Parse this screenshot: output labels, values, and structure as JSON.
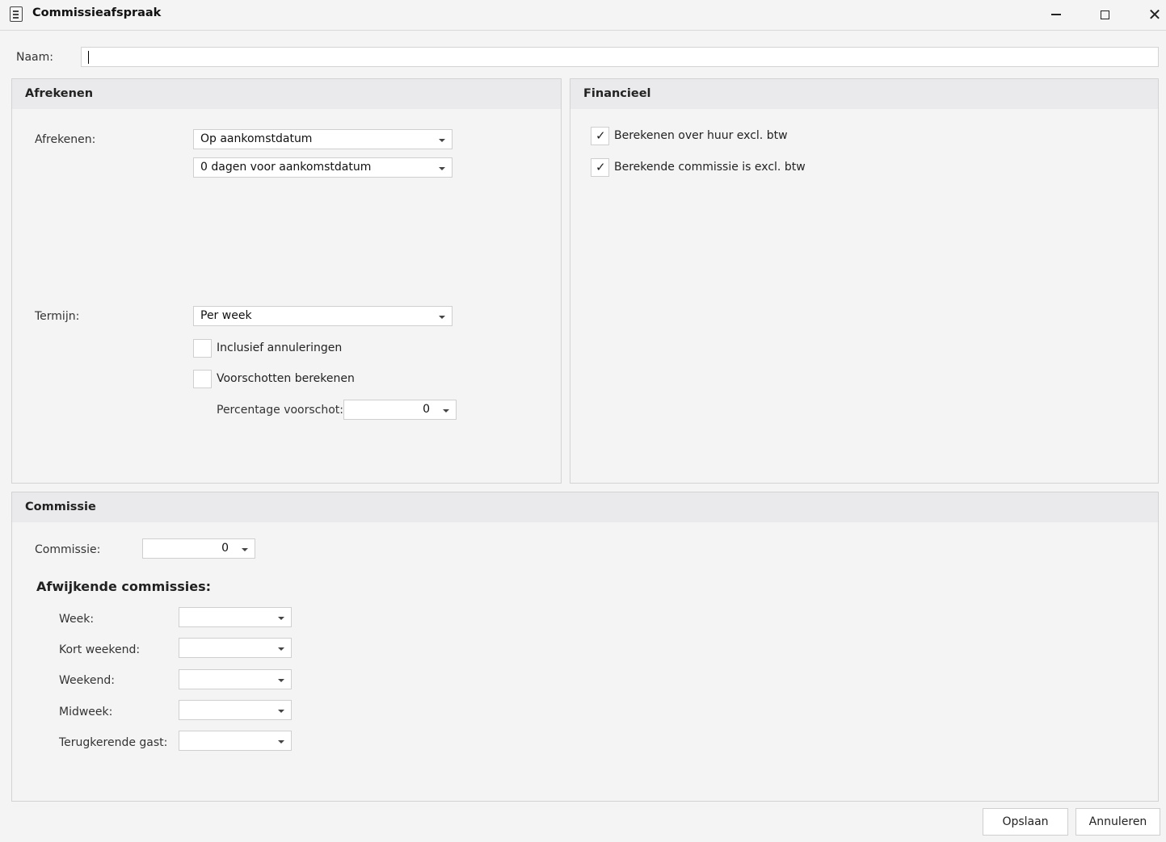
{
  "window": {
    "title": "Commissieafspraak",
    "icon": "document-icon"
  },
  "naam": {
    "label": "Naam:",
    "value": ""
  },
  "afrekenen": {
    "header": "Afrekenen",
    "afrekenen_label": "Afrekenen:",
    "afrekenen_value": "Op aankomstdatum",
    "dagen_value": "0 dagen voor aankomstdatum",
    "termijn_label": "Termijn:",
    "termijn_value": "Per week",
    "inclusief_label": "Inclusief annuleringen",
    "inclusief_checked": false,
    "voorschotten_label": "Voorschotten berekenen",
    "voorschotten_checked": false,
    "percentage_label": "Percentage voorschot:",
    "percentage_value": "0"
  },
  "financieel": {
    "header": "Financieel",
    "huur_label": "Berekenen over huur excl. btw",
    "huur_checked": true,
    "commissie_label": "Berekende commissie is excl. btw",
    "commissie_checked": true,
    "check_mark": "✓"
  },
  "commissie": {
    "header": "Commissie",
    "commissie_label": "Commissie:",
    "commissie_value": "0",
    "afwijkend_header": "Afwijkende commissies:",
    "rows": [
      {
        "label": "Week:",
        "value": ""
      },
      {
        "label": "Kort weekend:",
        "value": ""
      },
      {
        "label": "Weekend:",
        "value": ""
      },
      {
        "label": "Midweek:",
        "value": ""
      },
      {
        "label": "Terugkerende gast:",
        "value": ""
      }
    ]
  },
  "buttons": {
    "save": "Opslaan",
    "cancel": "Annuleren"
  }
}
